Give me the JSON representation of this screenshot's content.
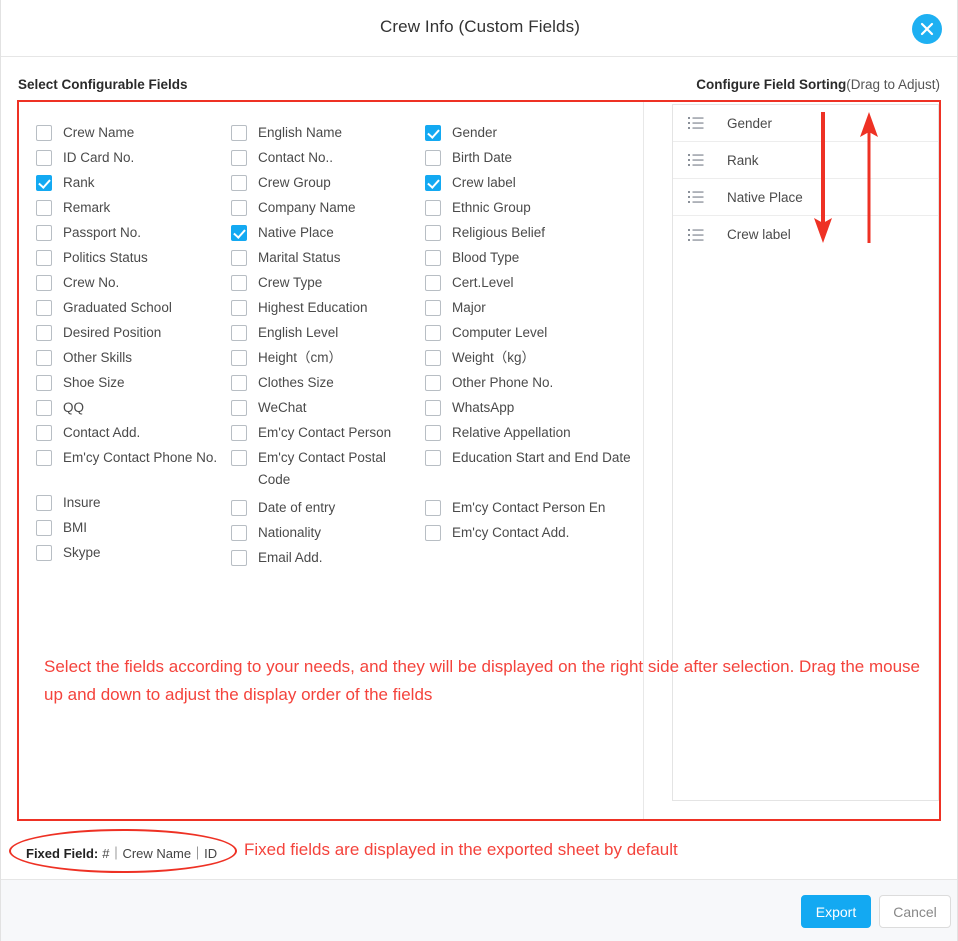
{
  "dialog": {
    "title": "Crew Info (Custom Fields)",
    "close_icon": "close-x-icon"
  },
  "headings": {
    "left": "Select Configurable Fields",
    "right_bold": "Configure Field Sorting",
    "right_sub": "(Drag to Adjust)"
  },
  "fields": {
    "columns": [
      [
        {
          "label": "Crew Name",
          "checked": false
        },
        {
          "label": "ID Card No.",
          "checked": false
        },
        {
          "label": "Rank",
          "checked": true
        },
        {
          "label": "Remark",
          "checked": false
        },
        {
          "label": "Passport No.",
          "checked": false
        },
        {
          "label": "Politics Status",
          "checked": false
        },
        {
          "label": "Crew No.",
          "checked": false
        },
        {
          "label": "Graduated School",
          "checked": false
        },
        {
          "label": "Desired Position",
          "checked": false
        },
        {
          "label": "Other Skills",
          "checked": false
        },
        {
          "label": "Shoe Size",
          "checked": false
        },
        {
          "label": "QQ",
          "checked": false
        },
        {
          "label": "Contact Add.",
          "checked": false
        },
        {
          "label": "Em'cy Contact Phone No.",
          "checked": false
        },
        {
          "label": "Insure",
          "checked": false,
          "gap_before": true
        },
        {
          "label": "BMI",
          "checked": false
        },
        {
          "label": "Skype",
          "checked": false
        }
      ],
      [
        {
          "label": "English Name",
          "checked": false
        },
        {
          "label": "Contact No..",
          "checked": false
        },
        {
          "label": "Crew Group",
          "checked": false
        },
        {
          "label": "Company Name",
          "checked": false
        },
        {
          "label": "Native Place",
          "checked": true
        },
        {
          "label": "Marital Status",
          "checked": false
        },
        {
          "label": "Crew Type",
          "checked": false
        },
        {
          "label": "Highest Education",
          "checked": false
        },
        {
          "label": "English Level",
          "checked": false
        },
        {
          "label": "Height（cm）",
          "checked": false
        },
        {
          "label": "Clothes Size",
          "checked": false
        },
        {
          "label": "WeChat",
          "checked": false
        },
        {
          "label": "Em'cy Contact Person",
          "checked": false
        },
        {
          "label": "Em'cy Contact Postal Code",
          "checked": false,
          "two_line": true
        },
        {
          "label": "Date of entry",
          "checked": false
        },
        {
          "label": "Nationality",
          "checked": false
        },
        {
          "label": "Email Add.",
          "checked": false
        }
      ],
      [
        {
          "label": "Gender",
          "checked": true
        },
        {
          "label": "Birth Date",
          "checked": false
        },
        {
          "label": "Crew label",
          "checked": true
        },
        {
          "label": "Ethnic Group",
          "checked": false
        },
        {
          "label": "Religious Belief",
          "checked": false
        },
        {
          "label": "Blood Type",
          "checked": false
        },
        {
          "label": "Cert.Level",
          "checked": false
        },
        {
          "label": "Major",
          "checked": false
        },
        {
          "label": "Computer Level",
          "checked": false
        },
        {
          "label": "Weight（kg）",
          "checked": false
        },
        {
          "label": "Other Phone No.",
          "checked": false
        },
        {
          "label": "WhatsApp",
          "checked": false
        },
        {
          "label": "Relative Appellation",
          "checked": false
        },
        {
          "label": "Education Start and End Date",
          "checked": false,
          "two_line": true
        },
        {
          "label": "Em'cy Contact Person En",
          "checked": false
        },
        {
          "label": "Em'cy Contact Add.",
          "checked": false
        }
      ]
    ]
  },
  "sorting": {
    "handle_icon": "drag-list-icon",
    "items": [
      {
        "label": "Gender"
      },
      {
        "label": "Rank"
      },
      {
        "label": "Native Place"
      },
      {
        "label": "Crew label"
      }
    ]
  },
  "annotations": {
    "instruction": "Select the fields according to your needs, and they will be displayed on the right side after selection. Drag the mouse up and down to adjust the display order of the fields",
    "fixed_note": "Fixed fields are displayed in the exported sheet by default",
    "arrow_down_icon": "arrow-down-icon",
    "arrow_up_icon": "arrow-up-icon"
  },
  "fixed_field": {
    "label": "Fixed Field:",
    "value": "#｜Crew Name｜ID"
  },
  "footer": {
    "export_label": "Export",
    "cancel_label": "Cancel"
  },
  "colors": {
    "accent": "#13a9f2",
    "annotation_red": "#f4433c",
    "border_red": "#ee3124"
  }
}
